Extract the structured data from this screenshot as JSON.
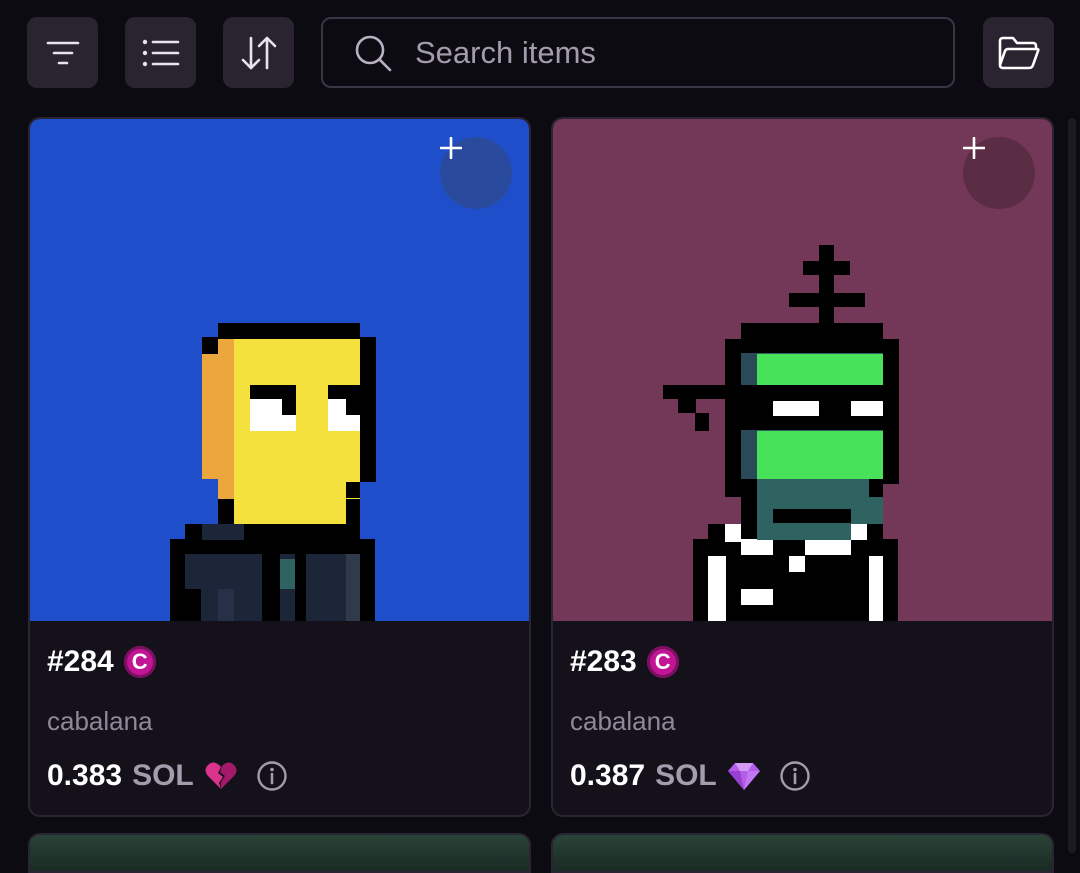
{
  "toolbar": {
    "filter_icon": "filter-icon",
    "list_icon": "list-icon",
    "sort_icon": "sort-icon",
    "folder_icon": "folder-icon"
  },
  "search": {
    "placeholder": "Search items",
    "value": ""
  },
  "colors": {
    "background": "#0d0b12",
    "button": "#2a2431",
    "card": "#14111a",
    "badge": "#c21596"
  },
  "cards": [
    {
      "number": "#284",
      "badge": "C",
      "collection": "cabalana",
      "price": "0.383",
      "currency": "SOL",
      "rarity_icon": "broken-heart-icon",
      "background": "#1e4ec9"
    },
    {
      "number": "#283",
      "badge": "C",
      "collection": "cabalana",
      "price": "0.387",
      "currency": "SOL",
      "rarity_icon": "diamond-icon",
      "background": "#733757"
    }
  ]
}
